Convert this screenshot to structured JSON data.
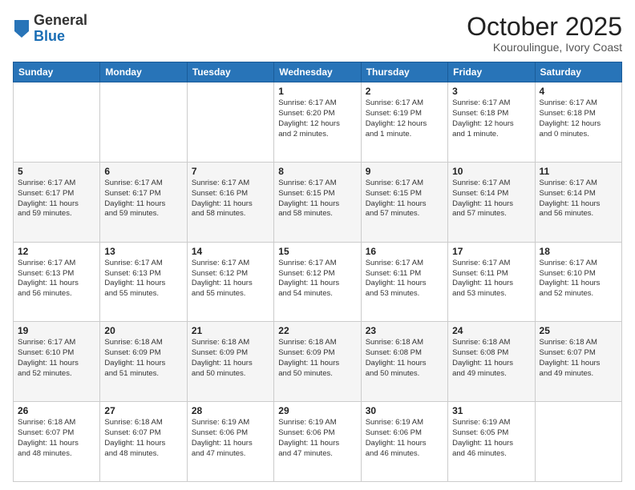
{
  "header": {
    "logo_general": "General",
    "logo_blue": "Blue",
    "month": "October 2025",
    "location": "Kouroulingue, Ivory Coast"
  },
  "weekdays": [
    "Sunday",
    "Monday",
    "Tuesday",
    "Wednesday",
    "Thursday",
    "Friday",
    "Saturday"
  ],
  "weeks": [
    [
      {
        "day": "",
        "info": ""
      },
      {
        "day": "",
        "info": ""
      },
      {
        "day": "",
        "info": ""
      },
      {
        "day": "1",
        "info": "Sunrise: 6:17 AM\nSunset: 6:20 PM\nDaylight: 12 hours\nand 2 minutes."
      },
      {
        "day": "2",
        "info": "Sunrise: 6:17 AM\nSunset: 6:19 PM\nDaylight: 12 hours\nand 1 minute."
      },
      {
        "day": "3",
        "info": "Sunrise: 6:17 AM\nSunset: 6:18 PM\nDaylight: 12 hours\nand 1 minute."
      },
      {
        "day": "4",
        "info": "Sunrise: 6:17 AM\nSunset: 6:18 PM\nDaylight: 12 hours\nand 0 minutes."
      }
    ],
    [
      {
        "day": "5",
        "info": "Sunrise: 6:17 AM\nSunset: 6:17 PM\nDaylight: 11 hours\nand 59 minutes."
      },
      {
        "day": "6",
        "info": "Sunrise: 6:17 AM\nSunset: 6:17 PM\nDaylight: 11 hours\nand 59 minutes."
      },
      {
        "day": "7",
        "info": "Sunrise: 6:17 AM\nSunset: 6:16 PM\nDaylight: 11 hours\nand 58 minutes."
      },
      {
        "day": "8",
        "info": "Sunrise: 6:17 AM\nSunset: 6:15 PM\nDaylight: 11 hours\nand 58 minutes."
      },
      {
        "day": "9",
        "info": "Sunrise: 6:17 AM\nSunset: 6:15 PM\nDaylight: 11 hours\nand 57 minutes."
      },
      {
        "day": "10",
        "info": "Sunrise: 6:17 AM\nSunset: 6:14 PM\nDaylight: 11 hours\nand 57 minutes."
      },
      {
        "day": "11",
        "info": "Sunrise: 6:17 AM\nSunset: 6:14 PM\nDaylight: 11 hours\nand 56 minutes."
      }
    ],
    [
      {
        "day": "12",
        "info": "Sunrise: 6:17 AM\nSunset: 6:13 PM\nDaylight: 11 hours\nand 56 minutes."
      },
      {
        "day": "13",
        "info": "Sunrise: 6:17 AM\nSunset: 6:13 PM\nDaylight: 11 hours\nand 55 minutes."
      },
      {
        "day": "14",
        "info": "Sunrise: 6:17 AM\nSunset: 6:12 PM\nDaylight: 11 hours\nand 55 minutes."
      },
      {
        "day": "15",
        "info": "Sunrise: 6:17 AM\nSunset: 6:12 PM\nDaylight: 11 hours\nand 54 minutes."
      },
      {
        "day": "16",
        "info": "Sunrise: 6:17 AM\nSunset: 6:11 PM\nDaylight: 11 hours\nand 53 minutes."
      },
      {
        "day": "17",
        "info": "Sunrise: 6:17 AM\nSunset: 6:11 PM\nDaylight: 11 hours\nand 53 minutes."
      },
      {
        "day": "18",
        "info": "Sunrise: 6:17 AM\nSunset: 6:10 PM\nDaylight: 11 hours\nand 52 minutes."
      }
    ],
    [
      {
        "day": "19",
        "info": "Sunrise: 6:17 AM\nSunset: 6:10 PM\nDaylight: 11 hours\nand 52 minutes."
      },
      {
        "day": "20",
        "info": "Sunrise: 6:18 AM\nSunset: 6:09 PM\nDaylight: 11 hours\nand 51 minutes."
      },
      {
        "day": "21",
        "info": "Sunrise: 6:18 AM\nSunset: 6:09 PM\nDaylight: 11 hours\nand 50 minutes."
      },
      {
        "day": "22",
        "info": "Sunrise: 6:18 AM\nSunset: 6:09 PM\nDaylight: 11 hours\nand 50 minutes."
      },
      {
        "day": "23",
        "info": "Sunrise: 6:18 AM\nSunset: 6:08 PM\nDaylight: 11 hours\nand 50 minutes."
      },
      {
        "day": "24",
        "info": "Sunrise: 6:18 AM\nSunset: 6:08 PM\nDaylight: 11 hours\nand 49 minutes."
      },
      {
        "day": "25",
        "info": "Sunrise: 6:18 AM\nSunset: 6:07 PM\nDaylight: 11 hours\nand 49 minutes."
      }
    ],
    [
      {
        "day": "26",
        "info": "Sunrise: 6:18 AM\nSunset: 6:07 PM\nDaylight: 11 hours\nand 48 minutes."
      },
      {
        "day": "27",
        "info": "Sunrise: 6:18 AM\nSunset: 6:07 PM\nDaylight: 11 hours\nand 48 minutes."
      },
      {
        "day": "28",
        "info": "Sunrise: 6:19 AM\nSunset: 6:06 PM\nDaylight: 11 hours\nand 47 minutes."
      },
      {
        "day": "29",
        "info": "Sunrise: 6:19 AM\nSunset: 6:06 PM\nDaylight: 11 hours\nand 47 minutes."
      },
      {
        "day": "30",
        "info": "Sunrise: 6:19 AM\nSunset: 6:06 PM\nDaylight: 11 hours\nand 46 minutes."
      },
      {
        "day": "31",
        "info": "Sunrise: 6:19 AM\nSunset: 6:05 PM\nDaylight: 11 hours\nand 46 minutes."
      },
      {
        "day": "",
        "info": ""
      }
    ]
  ]
}
